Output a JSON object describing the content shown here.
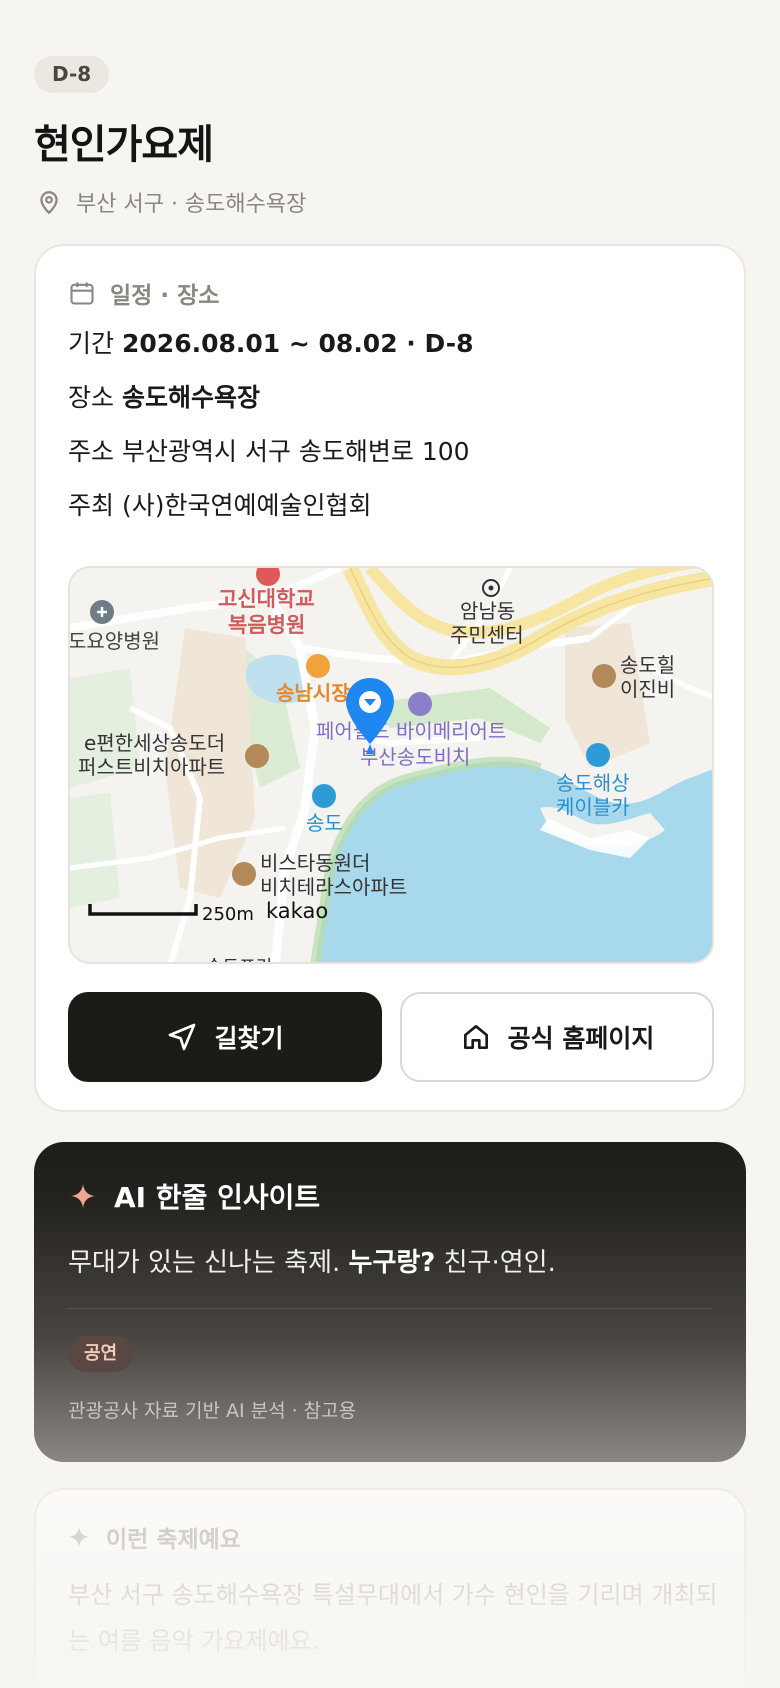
{
  "badge": "D-8",
  "festival": {
    "title": "현인가요제",
    "location": "부산 서구 · 송도해수욕장",
    "location_icon": "pin-icon"
  },
  "schedule": {
    "header": "일정 · 장소",
    "header_icon": "calendar-icon",
    "period_label": "기간",
    "period_value": "2026.08.01 ~ 08.02 · D-8",
    "venue_label": "장소",
    "venue_value": "송도해수욕장",
    "address_label": "주소",
    "address_value": "부산광역시 서구 송도해변로 100",
    "host_label": "주최",
    "host_value": "(사)한국연예예술인협회"
  },
  "map": {
    "labels": {
      "hospital": "고신대학교\n복음병원",
      "nursing": "요양병원",
      "amnam": "암남동\n주민센터",
      "songdo_apt_top": "송도힐\n이진비",
      "market": "송남시장",
      "hotel": "페어필드 바이메리어트\n부산송도비치",
      "cable": "송도해상\n케이블카",
      "e_apt": "e편한세상송도더\n퍼스트비치아파트",
      "songdo": "송도",
      "vista": "비스타동원더\n비치테라스아파트",
      "bottom": "송도프리",
      "scale": "250m",
      "provider": "kakao"
    },
    "colors": {
      "water": "#a7d8ec",
      "land": "#f4f3f0",
      "road": "#ffffff",
      "highway": "#f7e6a2",
      "park": "#d9ecd1",
      "pin": "#1e88f0"
    }
  },
  "actions": {
    "directions_label": "길찾기",
    "homepage_label": "공식 홈페이지"
  },
  "ai": {
    "header": "AI 한줄 인사이트",
    "text_prefix": "무대가 있는 신나는 축제. ",
    "text_bold": "누구랑?",
    "text_suffix": " 친구·연인.",
    "tag": "공연",
    "footnote": "관광공사 자료 기반 AI 분석 · 참고용"
  },
  "description": {
    "header": "이런 축제예요",
    "text": "부산 서구 송도해수욕장 특설무대에서 가수 현인을 기리며 개최되는 여름 음악 가요제예요."
  }
}
